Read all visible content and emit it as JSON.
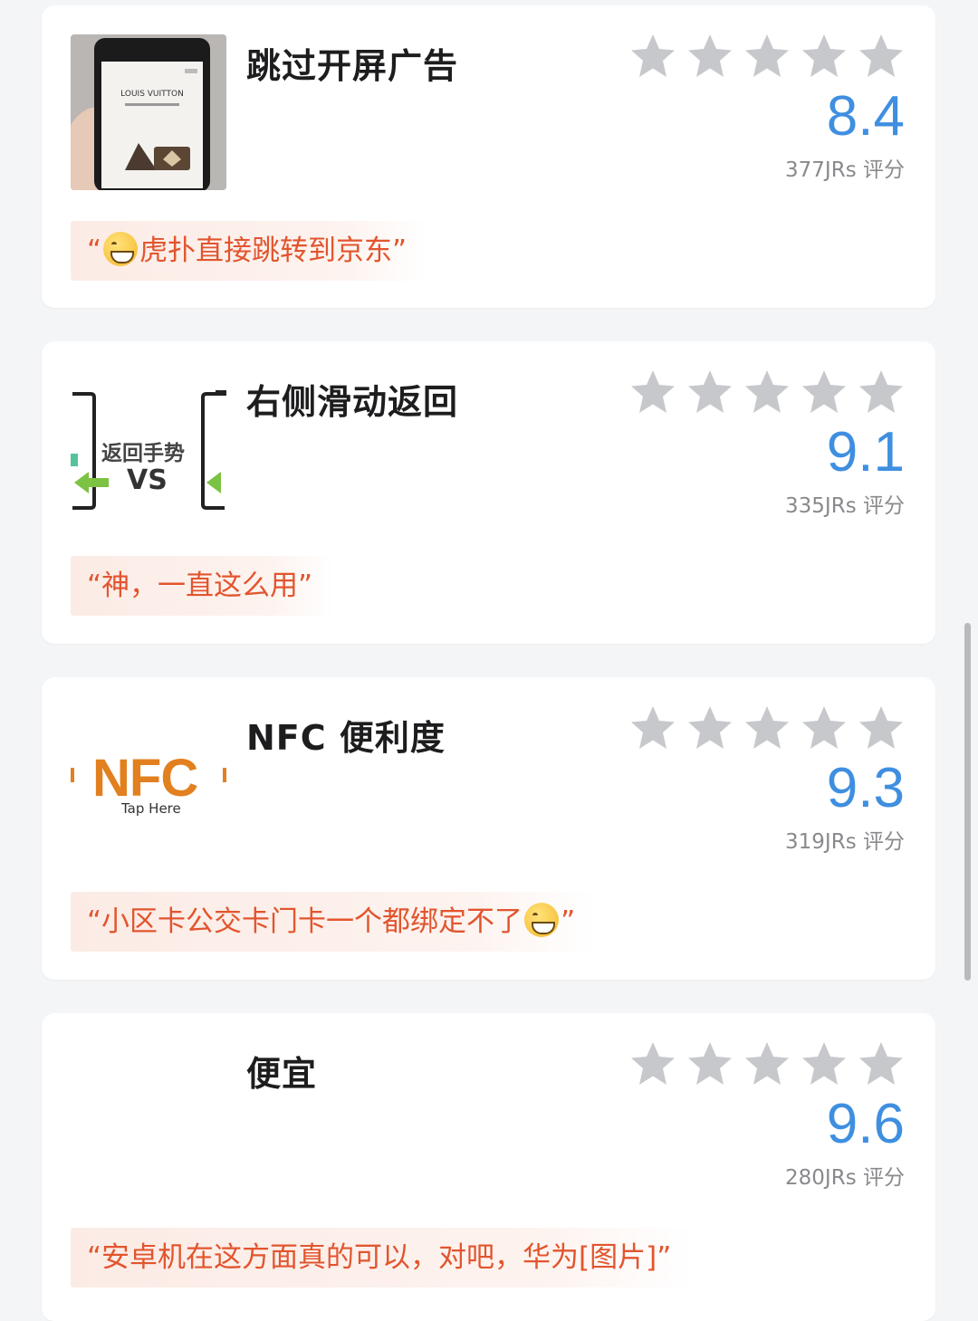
{
  "cards": [
    {
      "title": "跳过开屏广告",
      "score": "8.4",
      "votes": "377JRs 评分",
      "quote_open": "“",
      "quote_text": "虎扑直接跳转到京东”",
      "thumb_text": "LOUIS VUITTON",
      "rating_stars": 5
    },
    {
      "title": "右侧滑动返回",
      "score": "9.1",
      "votes": "335JRs 评分",
      "quote_text": "“神，一直这么用”",
      "thumb_text_1": "返回手势",
      "thumb_text_2": "VS",
      "rating_stars": 5
    },
    {
      "title": "NFC 便利度",
      "score": "9.3",
      "votes": "319JRs 评分",
      "quote_text": "“小区卡公交卡门卡一个都绑定不了",
      "quote_close": "”",
      "thumb_text_1": "NFC",
      "thumb_text_2": "Tap Here",
      "rating_stars": 5
    },
    {
      "title": "便宜",
      "score": "9.6",
      "votes": "280JRs 评分",
      "quote_text": "“安卓机在这方面真的可以，对吧，华为[图片]”",
      "rating_stars": 5
    }
  ],
  "colors": {
    "accent": "#3f8fe0",
    "quote": "#e2552e",
    "star": "#c7c8cc"
  },
  "icons": [
    "star-icon",
    "grinning-sweat-emoji"
  ]
}
